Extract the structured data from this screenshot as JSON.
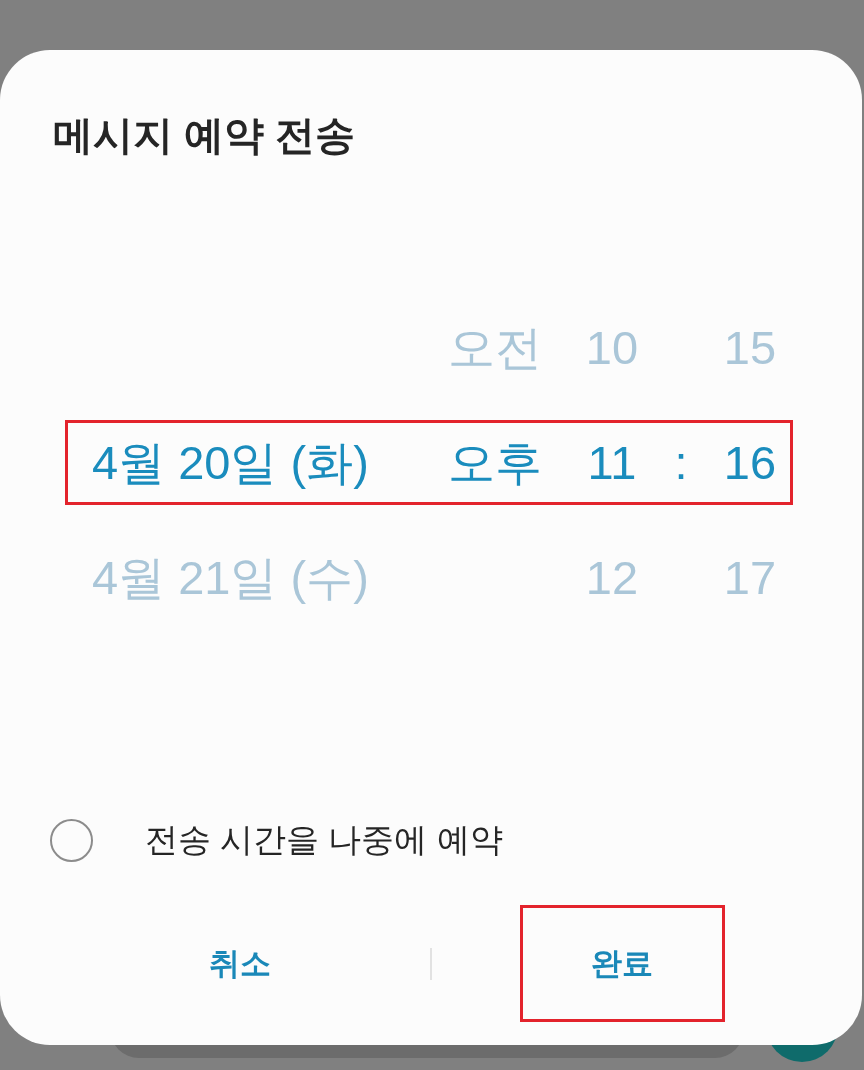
{
  "dialog": {
    "title": "메시지 예약 전송"
  },
  "picker": {
    "rows": [
      {
        "ampm": "오전",
        "hour": "10",
        "minute": "15",
        "selected": false,
        "highlighted": false
      },
      {
        "date": "4월 20일 (화)",
        "ampm": "오후",
        "hour": "11",
        "separator": ":",
        "minute": "16",
        "selected": true,
        "highlighted": true
      },
      {
        "date": "4월 21일 (수)",
        "hour": "12",
        "minute": "17",
        "selected": false,
        "highlighted": false
      }
    ]
  },
  "option": {
    "label": "전송 시간을 나중에 예약",
    "checked": false
  },
  "buttons": [
    {
      "label": "취소",
      "highlighted": false
    },
    {
      "label": "완료",
      "highlighted": true
    }
  ]
}
